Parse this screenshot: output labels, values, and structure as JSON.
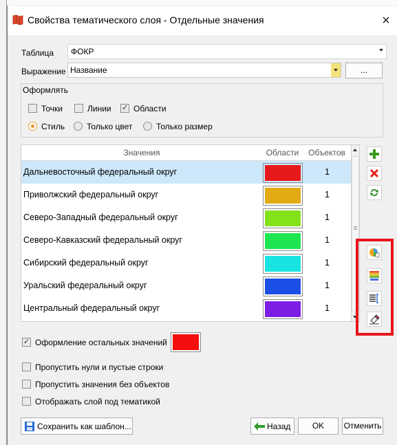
{
  "window": {
    "title": "Свойства тематического слоя - Отдельные значения",
    "close_glyph": "×"
  },
  "table_field": {
    "label": "Таблица",
    "value": "ФОКР"
  },
  "expression_field": {
    "label": "Выражение",
    "value": "Название",
    "button_label": "..."
  },
  "style_group": {
    "title": "Оформлять",
    "points_label": "Точки",
    "points_checked": false,
    "lines_label": "Линии",
    "lines_checked": false,
    "areas_label": "Области",
    "areas_checked": true,
    "radio_style": "Стиль",
    "radio_color": "Только цвет",
    "radio_size": "Только размер",
    "selected_radio": "Стиль"
  },
  "grid": {
    "columns": [
      "Значения",
      "Области",
      "Объектов"
    ],
    "rows": [
      {
        "name": "Дальневосточный федеральный округ",
        "color": "#e8191b",
        "count": "1",
        "selected": true
      },
      {
        "name": "Приволжский федеральный округ",
        "color": "#e2ab16",
        "count": "1",
        "selected": false
      },
      {
        "name": "Северо-Западный федеральный округ",
        "color": "#84e21a",
        "count": "1",
        "selected": false
      },
      {
        "name": "Северо-Кавказский федеральный округ",
        "color": "#1ee650",
        "count": "1",
        "selected": false
      },
      {
        "name": "Сибирский федеральный округ",
        "color": "#1ae4e2",
        "count": "1",
        "selected": false
      },
      {
        "name": "Уральский федеральный округ",
        "color": "#1b4ee6",
        "count": "1",
        "selected": false
      },
      {
        "name": "Центральный федеральный округ",
        "color": "#7c1de4",
        "count": "1",
        "selected": false
      }
    ],
    "partial_row_color": "#e21ab9"
  },
  "other_values": {
    "label": "Оформление остальных значений",
    "checked": true,
    "color": "#f50e0e"
  },
  "options": [
    {
      "label": "Пропустить нули и пустые строки",
      "checked": false
    },
    {
      "label": "Пропустить значения без объектов",
      "checked": false
    },
    {
      "label": "Отображать слой под тематикой",
      "checked": false
    }
  ],
  "buttons": {
    "save_template": "Сохранить как шаблон...",
    "back": "Назад",
    "ok": "OK",
    "cancel": "Отменить"
  },
  "icons": {
    "add": "plus-icon",
    "delete": "delete-icon",
    "refresh": "refresh-icon",
    "palette": "palette-icon",
    "gradient": "gradient-icon",
    "text_style": "text-style-icon",
    "eraser": "eraser-icon"
  },
  "colors": {
    "highlight_frame": "#e8141c",
    "selection": "#cde8fb"
  }
}
